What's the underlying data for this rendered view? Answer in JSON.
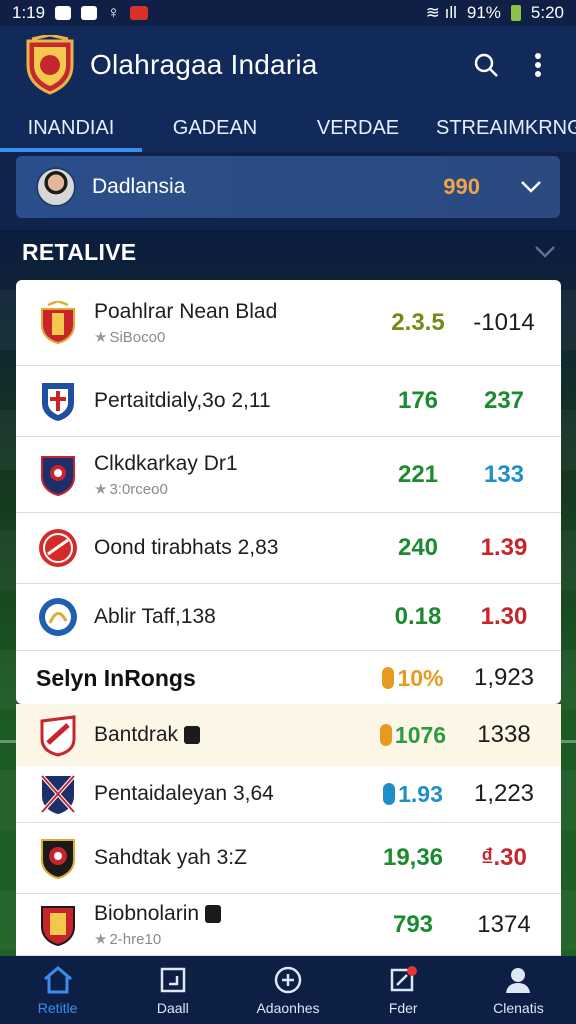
{
  "status_bar": {
    "time": "1:19",
    "battery": "91%",
    "clock": "5:20"
  },
  "app": {
    "title": "Olahragaa Indaria"
  },
  "tabs": [
    {
      "label": "INANDIAI",
      "active": true
    },
    {
      "label": "GADEAN",
      "active": false
    },
    {
      "label": "VERDAE",
      "active": false
    },
    {
      "label": "STREAIMKRNG",
      "active": false
    }
  ],
  "featured": {
    "name": "Dadlansia",
    "score": "990"
  },
  "section": {
    "title": "RETALIVE"
  },
  "rows": [
    {
      "name": "Poahlrar Nean Blad",
      "sub": "SiBoco0",
      "has_sub": true,
      "v1": "2.3.5",
      "v1_color": "#6e8c16",
      "v2": "-1014",
      "v2_color": "#1b1b1b",
      "crest": "crest-red-gold"
    },
    {
      "name": "Pertaitdialy,3o 2,11",
      "sub": "",
      "has_sub": false,
      "v1": "176",
      "v1_color": "#1c8a2f",
      "v2": "237",
      "v2_color": "#1c8a2f",
      "crest": "crest-blue-white"
    },
    {
      "name": "Clkdkarkay Dr1",
      "sub": "3:0rceo0",
      "has_sub": true,
      "v1": "221",
      "v1_color": "#1c8a2f",
      "v2": "133",
      "v2_color": "#1f8fc9",
      "crest": "crest-navy-red"
    },
    {
      "name": "Oond tirabhats 2,83",
      "sub": "",
      "has_sub": false,
      "v1": "240",
      "v1_color": "#1c8a2f",
      "v2": "1.39",
      "v2_color": "#c8242c",
      "crest": "crest-red-circle"
    },
    {
      "name": "Ablir Taff,138",
      "sub": "",
      "has_sub": false,
      "v1": "0.18",
      "v1_color": "#1c8a2f",
      "v2": "1.30",
      "v2_color": "#c8242c",
      "crest": "crest-blue-circle"
    }
  ],
  "summary": {
    "title": "Selyn InRongs",
    "pct": "10%",
    "pct_color": "#e79a1e",
    "value": "1,923"
  },
  "lower_rows": [
    {
      "name": "Bantdrak",
      "pct": "1076",
      "pct_color": "#2a9b3f",
      "pill_color": "#e79a1e",
      "value": "1338",
      "value_color": "#1b1b1b",
      "crest": "crest-red-white-2"
    },
    {
      "name": "Pentaidaleyan 3,64",
      "pct": "1.93",
      "pct_color": "#1f8fc9",
      "pill_color": "#1f8fc9",
      "value": "1,223",
      "value_color": "#1b1b1b",
      "crest": "crest-union"
    },
    {
      "name": "Sahdtak yah 3:Z",
      "pct": "19,36",
      "pct_color": "#1c8a2f",
      "pill_color": "",
      "value": "₫.30",
      "value_color": "#c8242c",
      "crest": "crest-black-red"
    },
    {
      "name": "Biobnolarin",
      "pct": "793",
      "pct_color": "#1c8a2f",
      "pill_color": "",
      "value": "1374",
      "value_color": "#1b1b1b",
      "crest": "crest-red-yellow"
    }
  ],
  "lower_sub": "2-hre10",
  "bottom_nav": [
    {
      "label": "Retitle",
      "icon": "home-icon",
      "active": true
    },
    {
      "label": "Daall",
      "icon": "square-icon",
      "active": false
    },
    {
      "label": "Adaonhes",
      "icon": "plus-circle-icon",
      "active": false
    },
    {
      "label": "Fder",
      "icon": "alert-icon",
      "active": false
    },
    {
      "label": "Clenatis",
      "icon": "person-icon",
      "active": false
    }
  ]
}
